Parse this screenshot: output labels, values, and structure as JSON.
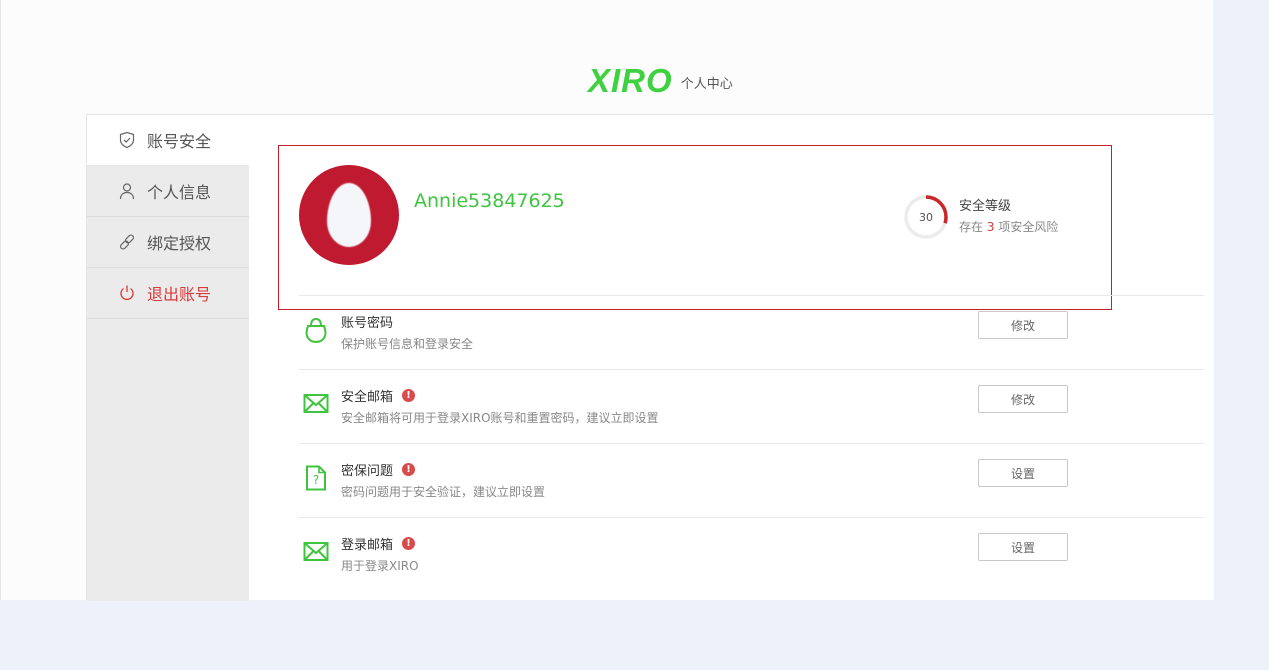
{
  "header": {
    "logo": "XIRO",
    "title": "个人中心"
  },
  "sidebar": {
    "items": [
      {
        "label": "账号安全",
        "icon": "shield-icon"
      },
      {
        "label": "个人信息",
        "icon": "user-icon"
      },
      {
        "label": "绑定授权",
        "icon": "link-icon"
      },
      {
        "label": "退出账号",
        "icon": "power-icon"
      }
    ]
  },
  "profile": {
    "username": "Annie53847625",
    "security_score": "30",
    "security_score_fraction": 0.3,
    "security_title": "安全等级",
    "risk_prefix": "存在",
    "risk_count": "3",
    "risk_suffix": "项安全风险"
  },
  "settings": [
    {
      "title": "账号密码",
      "desc": "保护账号信息和登录安全",
      "button": "修改",
      "warning": false,
      "icon": "lock-icon"
    },
    {
      "title": "安全邮箱",
      "desc": "安全邮箱将可用于登录XIRO账号和重置密码，建议立即设置",
      "button": "修改",
      "warning": true,
      "icon": "mail-icon"
    },
    {
      "title": "密保问题",
      "desc": "密码问题用于安全验证，建议立即设置",
      "button": "设置",
      "warning": true,
      "icon": "question-doc-icon"
    },
    {
      "title": "登录邮箱",
      "desc": "用于登录XIRO",
      "button": "设置",
      "warning": true,
      "icon": "mail-icon"
    }
  ],
  "warning_glyph": "!",
  "colors": {
    "brand": "#3fd13f",
    "danger": "#d93a3a",
    "highlight_border": "#c81d2a",
    "avatar_bg": "#c01a30"
  }
}
